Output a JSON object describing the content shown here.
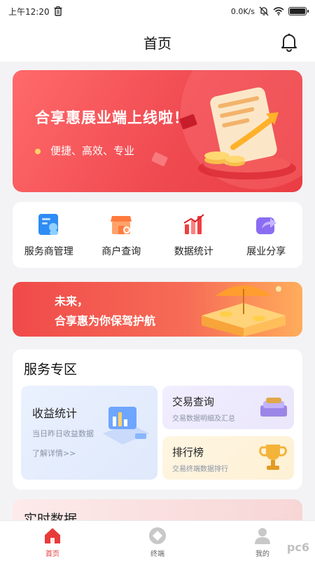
{
  "status_bar": {
    "time": "上午12:20",
    "net_speed": "0.0K/s"
  },
  "header": {
    "title": "首页",
    "icons": [
      "trash-icon",
      "bell-off-icon",
      "wifi-icon",
      "battery-icon",
      "bell-icon"
    ]
  },
  "banner": {
    "headline": "合享惠展业端上线啦！",
    "tagline": "便捷、高效、专业"
  },
  "quick_nav": {
    "items": [
      {
        "label": "服务商管理",
        "icon": "service-provider-icon"
      },
      {
        "label": "商户查询",
        "icon": "shop-search-icon"
      },
      {
        "label": "数据统计",
        "icon": "chart-icon"
      },
      {
        "label": "展业分享",
        "icon": "share-icon"
      }
    ]
  },
  "promo": {
    "line1": "未来，",
    "line2": "合享惠为你保驾护航"
  },
  "service_zone": {
    "title": "服务专区",
    "income": {
      "title": "收益统计",
      "subtitle": "当日昨日收益数据",
      "link": "了解详情>>"
    },
    "transaction": {
      "title": "交易查询",
      "subtitle": "交易数据明细及汇总"
    },
    "ranking": {
      "title": "排行榜",
      "subtitle": "交易终端数据排行"
    }
  },
  "realtime": {
    "title": "实时数据"
  },
  "tab_bar": {
    "tabs": [
      {
        "label": "首页",
        "icon": "home-icon"
      },
      {
        "label": "终端",
        "icon": "terminal-icon"
      },
      {
        "label": "我的",
        "icon": "user-icon"
      }
    ]
  },
  "colors": {
    "accent": "#e83b3b",
    "banner_red": "#f04b52",
    "background": "#f3f3f5"
  },
  "watermark": "pc6"
}
